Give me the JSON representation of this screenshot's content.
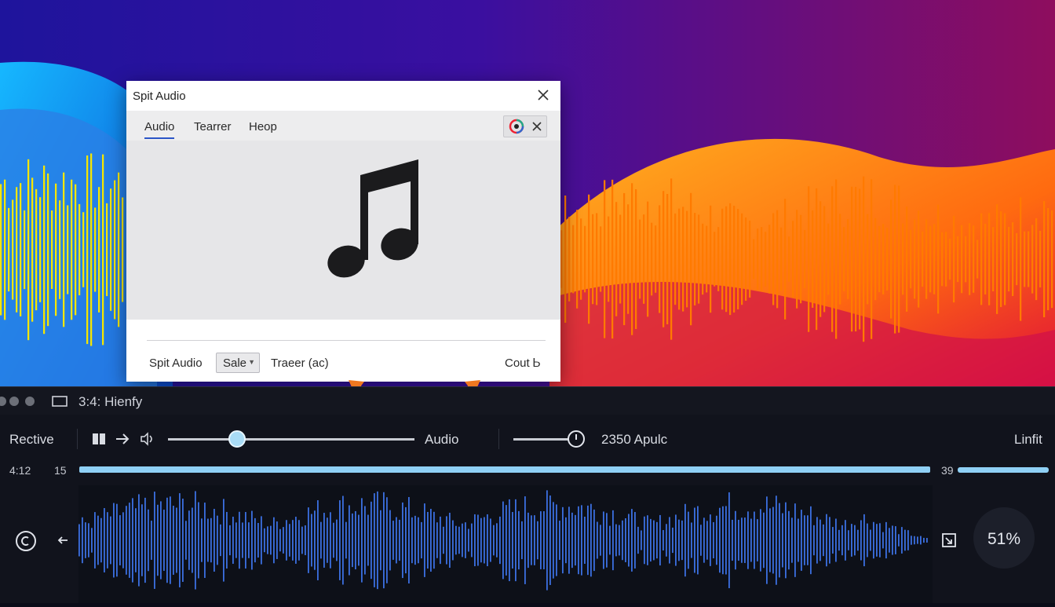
{
  "colors": {
    "bg_purple": "#2a0fa0",
    "bg_magenta": "#9e0f6a",
    "bg_blue": "#1aa0ff",
    "wave_yellow": "#f5e600",
    "wave_orange": "#ff7a00",
    "accent_blue": "#3b6fe0",
    "progress": "#8fd0f5",
    "arrow_orange": "#f07820"
  },
  "dialog": {
    "title": "Spit Audio",
    "tabs": [
      "Audio",
      "Tearrer",
      "Heop"
    ],
    "active_tab": "Audio",
    "preview_icon": "music-note-icon",
    "footer": {
      "label": "Spit Audio",
      "select_value": "Sale",
      "mid_text": "Traeer (ac)",
      "right_text": "Cout Ꮟ"
    }
  },
  "window2": {
    "title": "3:4: Hienfy"
  },
  "player": {
    "left_label": "Rective",
    "audio_label": "Audio",
    "volume_label": "2350 Apulc",
    "right_label": "Linfit",
    "time_left": "4:12",
    "time_small": "15",
    "time_right": "39",
    "seek_position": 0.28,
    "volume_level": 0.85,
    "progress_fraction": 1.0,
    "percent": "51%"
  }
}
